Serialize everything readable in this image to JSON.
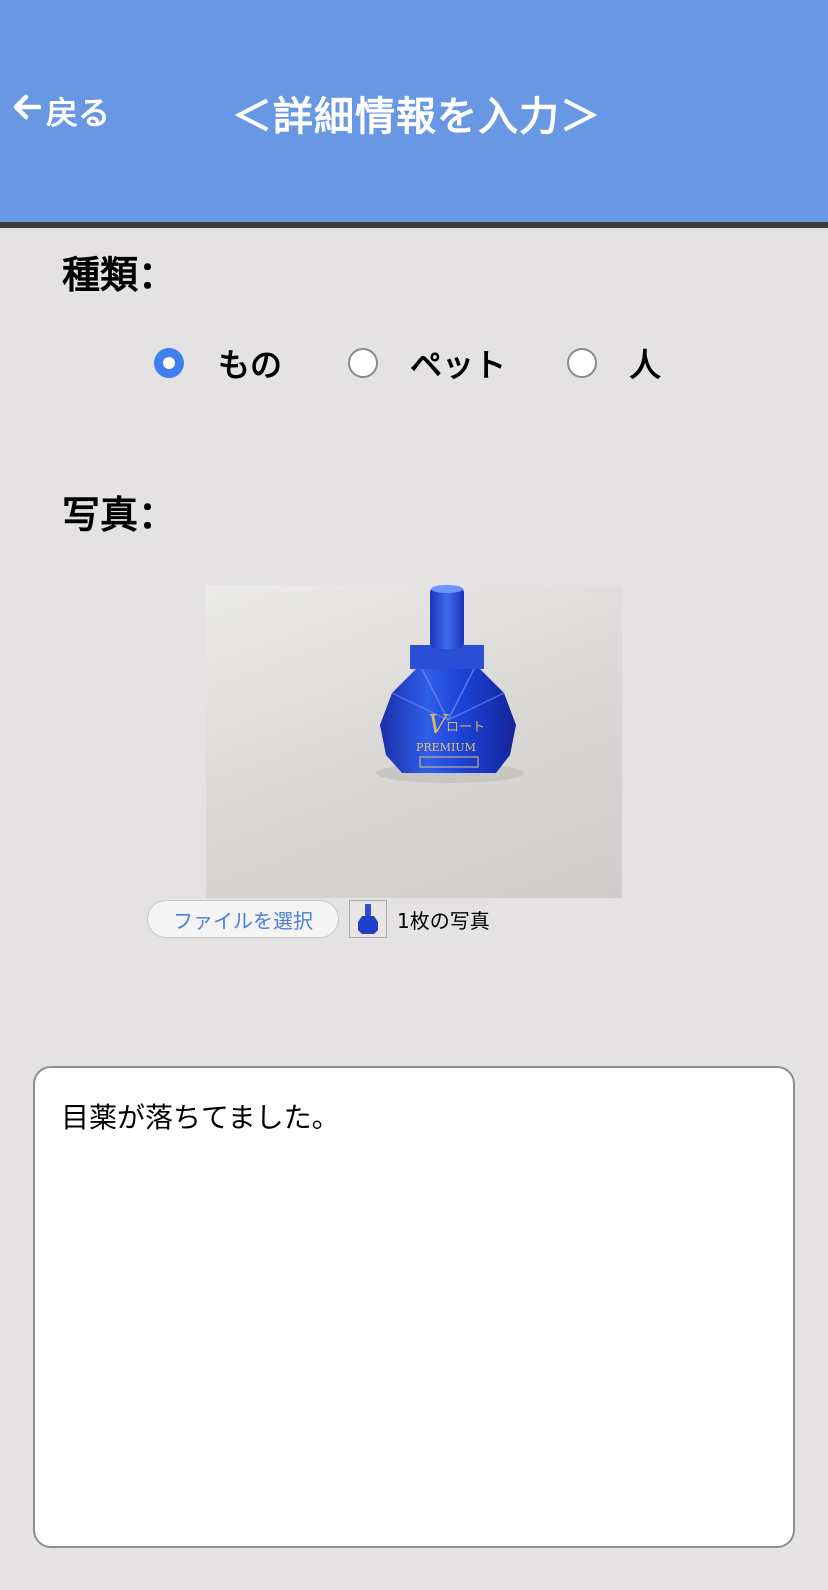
{
  "header": {
    "back_label": "戻る",
    "title": "＜詳細情報を入力＞",
    "background_color": "#6897e3"
  },
  "type_section": {
    "label": "種類：",
    "options": [
      {
        "label": "もの",
        "selected": true
      },
      {
        "label": "ペット",
        "selected": false
      },
      {
        "label": "人",
        "selected": false
      }
    ]
  },
  "photo_section": {
    "label": "写真：",
    "file_button_label": "ファイルを選択",
    "file_count_text": "1枚の写真"
  },
  "description": {
    "value": "目薬が落ちてました。"
  },
  "colors": {
    "accent": "#3f80f0",
    "page_background": "#e4e2e3"
  }
}
